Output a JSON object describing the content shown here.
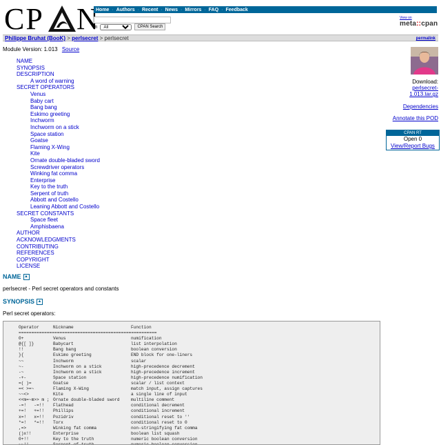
{
  "header": {
    "logo": {
      "left": "CP",
      "right": "N"
    },
    "nav": [
      "Home",
      "Authors",
      "Recent",
      "News",
      "Mirrors",
      "FAQ",
      "Feedback"
    ],
    "search": {
      "in_label": "in",
      "select_value": "All",
      "button": "CPAN Search"
    },
    "metacpan": {
      "view_on": "View on",
      "brand_a": "meta",
      "brand_dots": "::",
      "brand_b": "cpan"
    }
  },
  "breadcrumb": {
    "author": "Philippe Bruhat (BooK)",
    "sep": ">",
    "dist": "perlsecret",
    "current": "perlsecret",
    "permalink": "permalink"
  },
  "module": {
    "version_text": "Module Version: 1.013",
    "source": "Source"
  },
  "toc": [
    {
      "label": "NAME",
      "level": 0
    },
    {
      "label": "SYNOPSIS",
      "level": 0
    },
    {
      "label": "DESCRIPTION",
      "level": 0
    },
    {
      "label": "A word of warning",
      "level": 1
    },
    {
      "label": "SECRET OPERATORS",
      "level": 0
    },
    {
      "label": "Venus",
      "level": 1
    },
    {
      "label": "Baby cart",
      "level": 1
    },
    {
      "label": "Bang bang",
      "level": 1
    },
    {
      "label": "Eskimo greeting",
      "level": 1
    },
    {
      "label": "Inchworm",
      "level": 1
    },
    {
      "label": "Inchworm on a stick",
      "level": 1
    },
    {
      "label": "Space station",
      "level": 1
    },
    {
      "label": "Goatse",
      "level": 1
    },
    {
      "label": "Flaming X-Wing",
      "level": 1
    },
    {
      "label": "Kite",
      "level": 1
    },
    {
      "label": "Ornate double-bladed sword",
      "level": 1
    },
    {
      "label": "Screwdriver operators",
      "level": 1
    },
    {
      "label": "Winking fat comma",
      "level": 1
    },
    {
      "label": "Enterprise",
      "level": 1
    },
    {
      "label": "Key to the truth",
      "level": 1
    },
    {
      "label": "Serpent of truth",
      "level": 1
    },
    {
      "label": "Abbott and Costello",
      "level": 1
    },
    {
      "label": "Leaning Abbott and Costello",
      "level": 1
    },
    {
      "label": "SECRET CONSTANTS",
      "level": 0
    },
    {
      "label": "Space fleet",
      "level": 1
    },
    {
      "label": "Amphisbaena",
      "level": 1
    },
    {
      "label": "AUTHOR",
      "level": 0
    },
    {
      "label": "ACKNOWLEDGMENTS",
      "level": 0
    },
    {
      "label": "CONTRIBUTING",
      "level": 0
    },
    {
      "label": "REFERENCES",
      "level": 0
    },
    {
      "label": "COPYRIGHT",
      "level": 0
    },
    {
      "label": "LICENSE",
      "level": 0
    }
  ],
  "sidebar": {
    "download_label": "Download:",
    "download_link_1": "perlsecret-",
    "download_link_2": "1.013.tar.gz",
    "dependencies": "Dependencies",
    "annotate": "Annotate this POD",
    "rt_header": "CPAN RT",
    "rt_open": "Open  0",
    "rt_link": "View/Report Bugs"
  },
  "sections": {
    "name_heading": "NAME",
    "name_text": "perlsecret - Perl secret operators and constants",
    "synopsis_heading": "SYNOPSIS",
    "synopsis_text": "Perl secret operators:"
  },
  "code": {
    "header": [
      "Operator",
      "Nickname",
      "Function"
    ],
    "rule": "======================================================",
    "rows": [
      [
        "0+",
        "Venus",
        "numification"
      ],
      [
        "@{[ ]}",
        "Babycart",
        "list interpolation"
      ],
      [
        "!!",
        "Bang bang",
        "boolean conversion"
      ],
      [
        "}{",
        "Eskimo greeting",
        "END block for one-liners"
      ],
      [
        "~~",
        "Inchworm",
        "scalar"
      ],
      [
        "~-",
        "Inchworm on a stick",
        "high-precedence decrement"
      ],
      [
        "-~",
        "Inchworm on a stick",
        "high-precedence increment"
      ],
      [
        "-+-",
        "Space station",
        "high-precedence numification"
      ],
      [
        "=( )=",
        "Goatse",
        "scalar / list context"
      ],
      [
        "=< >=~",
        "Flaming X-Wing",
        "match input, assign captures"
      ],
      [
        "~~<>",
        "Kite",
        "a single line of input"
      ],
      [
        "<<m=~m>> m ;",
        "Ornate double-bladed sword",
        "multiline comment"
      ],
      [
        "-=!   -=!!",
        "Flathead",
        "conditional decrement"
      ],
      [
        "+=!   +=!!",
        "Phillips",
        "conditional increment"
      ],
      [
        "x=!   x=!!",
        "Pozidriv",
        "conditional reset to ''"
      ],
      [
        "*=!   *=!!",
        "Torx",
        "conditional reset to 0"
      ],
      [
        ",=>",
        "Winking fat comma",
        "non-stringifying fat comma"
      ],
      [
        "()x!!",
        "Enterprise",
        "boolean list squash"
      ],
      [
        "0+!!",
        "Key to the truth",
        "numeric boolean conversion"
      ],
      [
        "~~!!",
        "Serpent of truth",
        "numeric boolean conversion"
      ]
    ]
  }
}
